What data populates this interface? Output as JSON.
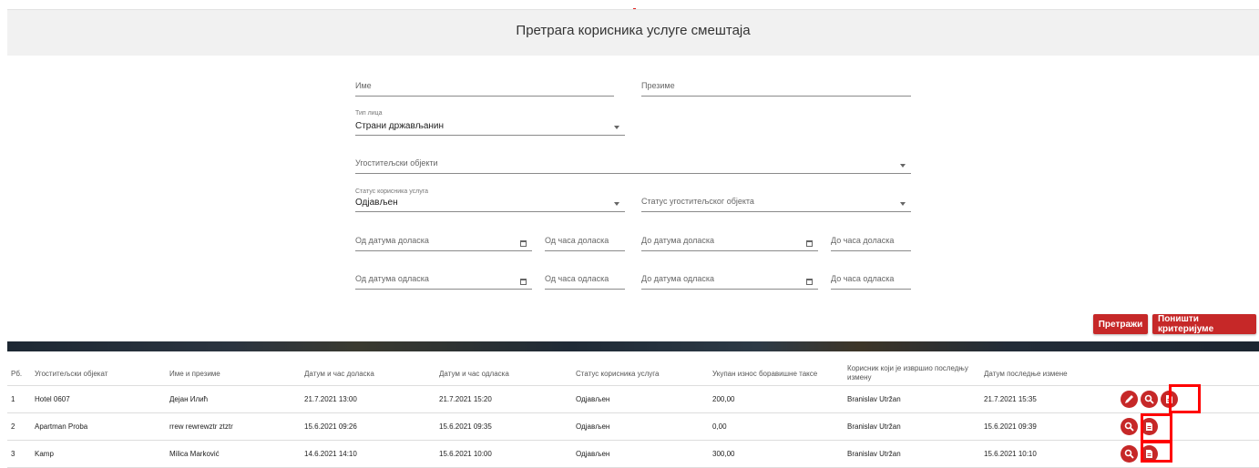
{
  "header": {
    "title": "Претрага корисника услуге смештаја"
  },
  "form": {
    "ime": "Име",
    "prezime": "Презиме",
    "tip_lica_label": "Тип лица",
    "tip_lica_value": "Страни држављанин",
    "ugostiteljski_objekti": "Угоститељски објекти",
    "status_korisnika_label": "Статус корисника услуга",
    "status_korisnika_value": "Одјављен",
    "status_objekta": "Статус угоститељског објекта",
    "od_datuma_dolaska": "Од датума доласка",
    "od_casa_dolaska": "Од часа доласка",
    "do_datuma_dolaska": "До датума доласка",
    "do_casa_dolaska": "До часа доласка",
    "od_datuma_odlaska": "Од датума одласка",
    "od_casa_odlaska": "Од часа одласка",
    "do_datuma_odlaska": "До датума одласка",
    "do_casa_odlaska": "До часа одласка"
  },
  "buttons": {
    "search": "Претражи",
    "reset": "Поништи критеријуме"
  },
  "table": {
    "headers": {
      "rb": "Рб.",
      "objekat": "Угоститељски објекат",
      "ime_prezime": "Име и презиме",
      "dolazak": "Датум и час доласка",
      "odlazak": "Датум и час одласка",
      "status": "Статус корисника услуга",
      "iznos": "Укупан износ боравишне таксе",
      "korisnik": "Корисник који је извршио последњу измену",
      "datum_izmene": "Датум последње измене"
    },
    "rows": [
      {
        "rb": "1",
        "objekat": "Hotel 0607",
        "ime_prezime": "Дејан Илић",
        "dolazak": "21.7.2021 13:00",
        "odlazak": "21.7.2021 15:20",
        "status": "Одјављен",
        "iznos": "200,00",
        "korisnik": "Branislav Utržan",
        "datum_izmene": "21.7.2021 15:35"
      },
      {
        "rb": "2",
        "objekat": "Apartman Proba",
        "ime_prezime": "rrew rewrewztr ztztr",
        "dolazak": "15.6.2021 09:26",
        "odlazak": "15.6.2021 09:35",
        "status": "Одјављен",
        "iznos": "0,00",
        "korisnik": "Branislav Utržan",
        "datum_izmene": "15.6.2021 09:39"
      },
      {
        "rb": "3",
        "objekat": "Kamp",
        "ime_prezime": "Milica Marković",
        "dolazak": "14.6.2021 14:10",
        "odlazak": "15.6.2021 10:00",
        "status": "Одјављен",
        "iznos": "300,00",
        "korisnik": "Branislav Utržan",
        "datum_izmene": "15.6.2021 10:10"
      }
    ]
  },
  "colors": {
    "accent": "#c62828",
    "highlight": "#ff0000"
  },
  "icons": [
    "edit-icon",
    "search-icon",
    "document-icon",
    "calendar-icon",
    "chevron-down-icon"
  ]
}
